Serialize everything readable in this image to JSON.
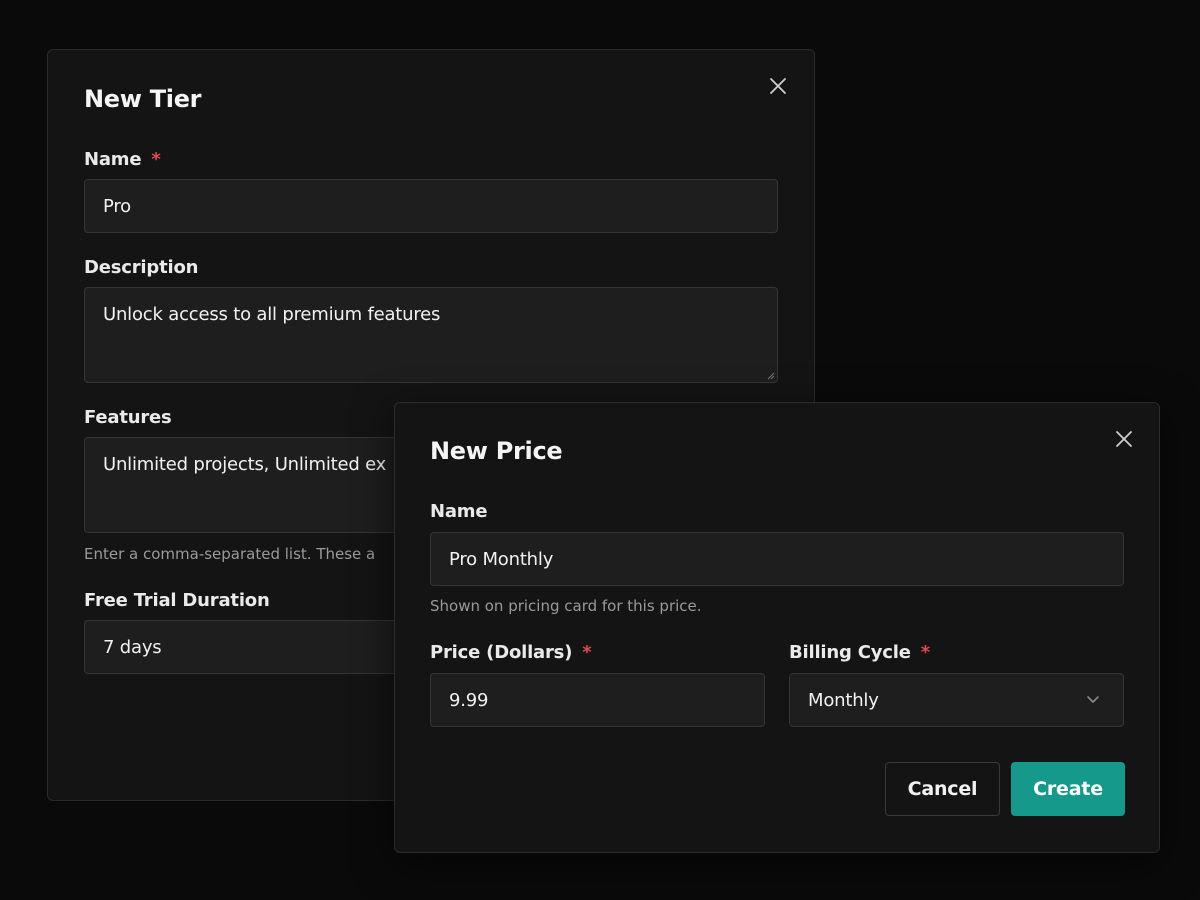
{
  "tier_dialog": {
    "title": "New Tier",
    "name_label": "Name",
    "name_value": "Pro",
    "description_label": "Description",
    "description_value": "Unlock access to all premium features",
    "features_label": "Features",
    "features_value": "Unlimited projects, Unlimited ex",
    "features_hint": "Enter a comma-separated list. These a",
    "trial_label": "Free Trial Duration",
    "trial_value": "7 days",
    "required_mark": "*"
  },
  "price_dialog": {
    "title": "New Price",
    "name_label": "Name",
    "name_value": "Pro Monthly",
    "name_hint": "Shown on pricing card for this price.",
    "price_label": "Price (Dollars)",
    "price_value": "9.99",
    "cycle_label": "Billing Cycle",
    "cycle_value": "Monthly",
    "required_mark": "*",
    "cancel_label": "Cancel",
    "create_label": "Create"
  },
  "colors": {
    "background": "#0a0a0b",
    "dialog": "#141414",
    "input": "#1e1e1e",
    "accent": "#14998a",
    "required": "#e5484d"
  },
  "icons": [
    "close-icon",
    "chevron-down-icon",
    "resize-grip-icon"
  ]
}
